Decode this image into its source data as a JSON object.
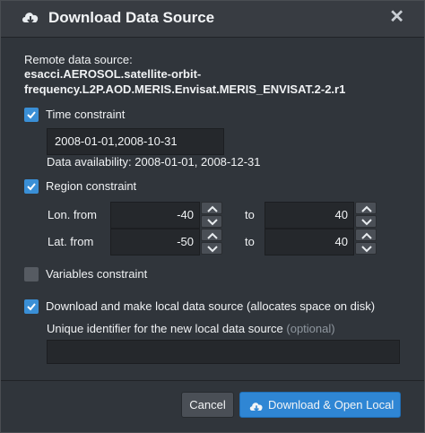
{
  "dialog": {
    "title": "Download Data Source",
    "title_icon": "cloud-download-icon",
    "close_glyph": "✕"
  },
  "remote": {
    "label": "Remote data source:",
    "line1": "esacci.AEROSOL.satellite-orbit-",
    "line2": "frequency.L2P.AOD.MERIS.Envisat.MERIS_ENVISAT.2-2.r1"
  },
  "time": {
    "label": "Time constraint",
    "checked": true,
    "value": "2008-01-01,2008-10-31",
    "availability": "Data availability: 2008-01-01, 2008-12-31"
  },
  "region": {
    "label": "Region constraint",
    "checked": true,
    "lon_label": "Lon. from",
    "lat_label": "Lat. from",
    "to_label": "to",
    "lon_from": "-40",
    "lon_to": "40",
    "lat_from": "-50",
    "lat_to": "40"
  },
  "variables": {
    "label": "Variables constraint",
    "checked": false
  },
  "local": {
    "label": "Download and make local data source (allocates space on disk)",
    "checked": true,
    "id_label": "Unique identifier for the new local data source",
    "id_optional": "(optional)",
    "id_value": ""
  },
  "buttons": {
    "cancel": "Cancel",
    "primary": "Download & Open Local"
  },
  "colors": {
    "accent": "#2f86d4",
    "background": "#30353b"
  }
}
